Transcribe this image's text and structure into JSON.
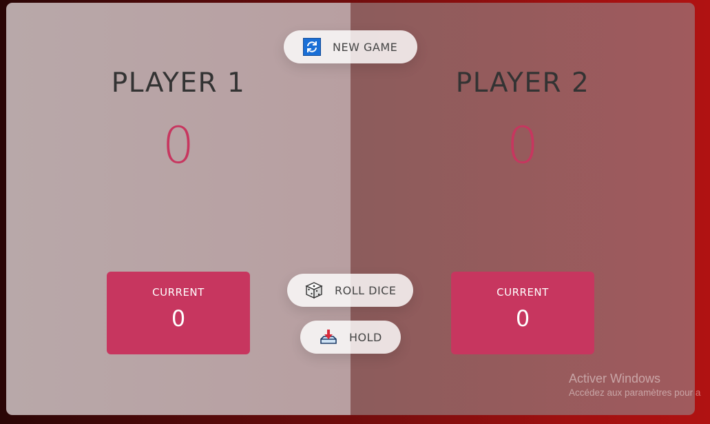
{
  "players": [
    {
      "name": "PLAYER 1",
      "score": "0",
      "current_label": "CURRENT",
      "current_score": "0"
    },
    {
      "name": "PLAYER 2",
      "score": "0",
      "current_label": "CURRENT",
      "current_score": "0"
    }
  ],
  "buttons": {
    "new_game": {
      "label": "NEW GAME",
      "icon": "refresh-icon"
    },
    "roll_dice": {
      "label": "ROLL DICE",
      "icon": "dice-icon"
    },
    "hold": {
      "label": "HOLD",
      "icon": "download-tray-icon"
    }
  },
  "watermark": {
    "title": "Activer Windows",
    "subtitle": "Accédez aux paramètres pour a"
  },
  "colors": {
    "accent": "#c7365f",
    "player1_panel": "#b8a8a9",
    "player2_panel": "#955d5e",
    "text": "#333333"
  }
}
